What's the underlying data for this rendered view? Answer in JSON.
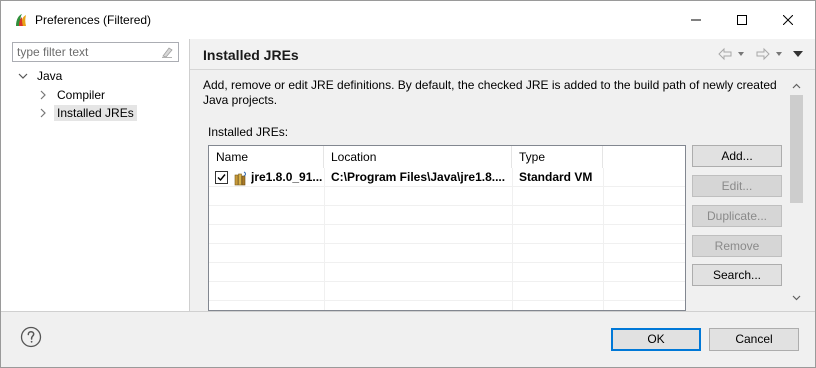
{
  "window": {
    "title": "Preferences (Filtered)",
    "app_icon": "eclipse-icon",
    "controls": [
      "minimize-icon",
      "maximize-icon",
      "close-icon"
    ]
  },
  "sidebar": {
    "filter_placeholder": "type filter text",
    "tree": [
      {
        "label": "Java",
        "expanded": true
      },
      {
        "label": "Compiler",
        "expanded": false
      },
      {
        "label": "Installed JREs",
        "expanded": false,
        "selected": true
      }
    ]
  },
  "page": {
    "title": "Installed JREs",
    "description": "Add, remove or edit JRE definitions. By default, the checked JRE is added to the build path of newly created Java projects.",
    "installed_label": "Installed JREs:"
  },
  "table": {
    "columns": [
      "Name",
      "Location",
      "Type"
    ],
    "rows": [
      {
        "checked": true,
        "name": "jre1.8.0_91...",
        "location": "C:\\Program Files\\Java\\jre1.8....",
        "type": "Standard VM"
      }
    ]
  },
  "buttons": {
    "add": "Add...",
    "edit": "Edit...",
    "duplicate": "Duplicate...",
    "remove": "Remove",
    "search": "Search..."
  },
  "footer": {
    "ok": "OK",
    "cancel": "Cancel"
  },
  "colors": {
    "accent": "#0078d7",
    "panel_bg": "#f0f0f0"
  }
}
